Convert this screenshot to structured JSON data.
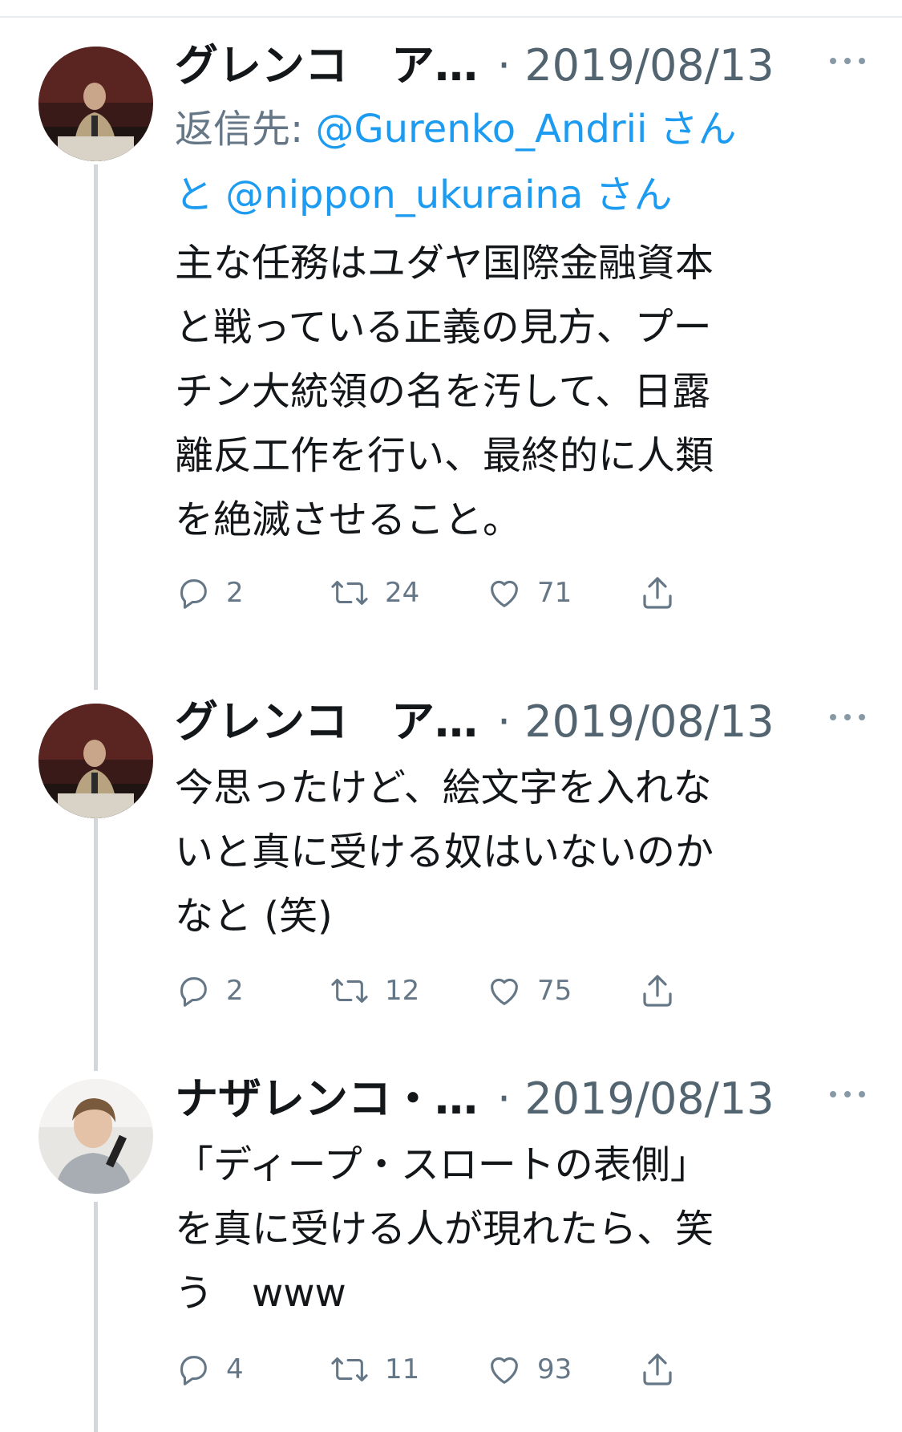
{
  "tweets": [
    {
      "name": "グレンコ　ア…",
      "date": "· 2019/08/13",
      "reply_prefix": "返信先: ",
      "mention1": "@Gurenko_Andrii さん",
      "reply_join": "と ",
      "mention2": "@nippon_ukuraina さん",
      "lines": [
        "主な任務はユダヤ国際金融資本",
        "と戦っている正義の見方、プー",
        "チン大統領の名を汚して、日露",
        "離反工作を行い、最終的に人類",
        "を絶滅させること。"
      ],
      "replies": "2",
      "retweets": "24",
      "likes": "71"
    },
    {
      "name": "グレンコ　ア…",
      "date": "· 2019/08/13",
      "lines": [
        "今思ったけど、絵文字を入れな",
        "いと真に受ける奴はいないのか",
        "なと (笑)"
      ],
      "replies": "2",
      "retweets": "12",
      "likes": "75"
    },
    {
      "name": "ナザレンコ・…",
      "date": "· 2019/08/13",
      "lines": [
        "「ディープ・スロートの表側」",
        "を真に受ける人が現れたら、笑",
        "う　www"
      ],
      "replies": "4",
      "retweets": "11",
      "likes": "93"
    }
  ],
  "icons": {
    "more": "more-horizontal-icon",
    "reply": "speech-bubble-icon",
    "retweet": "retweet-arrows-icon",
    "like": "heart-icon",
    "share": "share-upload-icon",
    "avatar": "profile-photo-icon"
  },
  "colors": {
    "mention": "#1d9bf0",
    "meta": "#536471",
    "thread_line": "#d3d6da"
  }
}
